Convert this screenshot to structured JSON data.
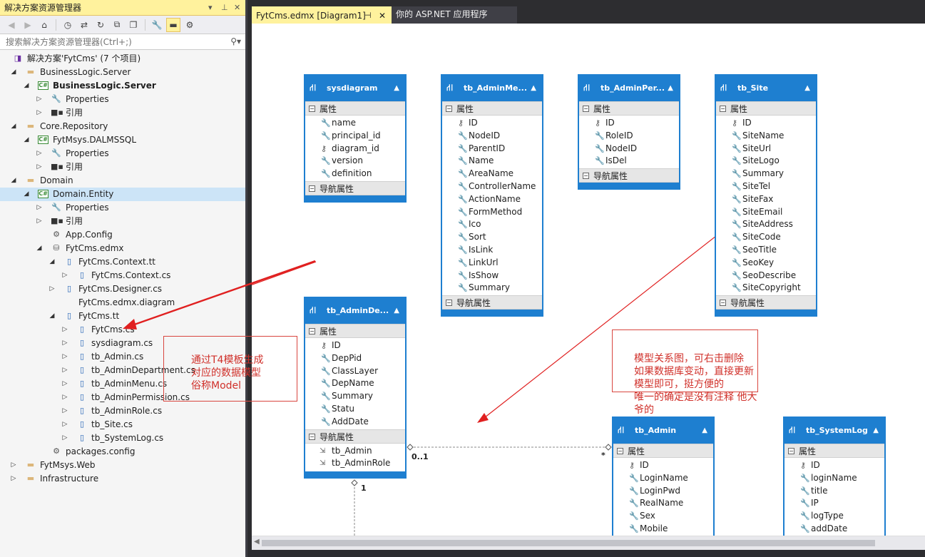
{
  "solution_explorer": {
    "title": "解决方案资源管理器",
    "title_controls": [
      "▾",
      "⊥",
      "✕"
    ],
    "search_placeholder": "搜索解决方案资源管理器(Ctrl+;)",
    "tree": [
      {
        "label": "解决方案'FytCms' (7 个项目)",
        "icon": "solution-icon",
        "depth": 0,
        "expander": ""
      },
      {
        "label": "BusinessLogic.Server",
        "icon": "folder-icon",
        "depth": 1,
        "expander": "open"
      },
      {
        "label": "BusinessLogic.Server",
        "icon": "csharp-project-icon",
        "depth": 2,
        "expander": "open",
        "bold": true
      },
      {
        "label": "Properties",
        "icon": "wrench-icon",
        "depth": 3,
        "expander": "closed"
      },
      {
        "label": "引用",
        "icon": "references-icon",
        "depth": 3,
        "expander": "closed"
      },
      {
        "label": "Core.Repository",
        "icon": "folder-icon",
        "depth": 1,
        "expander": "open"
      },
      {
        "label": "FytMsys.DALMSSQL",
        "icon": "csharp-project-icon",
        "depth": 2,
        "expander": "open"
      },
      {
        "label": "Properties",
        "icon": "wrench-icon",
        "depth": 3,
        "expander": "closed"
      },
      {
        "label": "引用",
        "icon": "references-icon",
        "depth": 3,
        "expander": "closed"
      },
      {
        "label": "Domain",
        "icon": "folder-icon",
        "depth": 1,
        "expander": "open"
      },
      {
        "label": "Domain.Entity",
        "icon": "csharp-project-icon",
        "depth": 2,
        "expander": "open",
        "selected": true
      },
      {
        "label": "Properties",
        "icon": "wrench-icon",
        "depth": 3,
        "expander": "closed"
      },
      {
        "label": "引用",
        "icon": "references-icon",
        "depth": 3,
        "expander": "closed"
      },
      {
        "label": "App.Config",
        "icon": "config-file-icon",
        "depth": 3,
        "expander": ""
      },
      {
        "label": "FytCms.edmx",
        "icon": "edmx-file-icon",
        "depth": 3,
        "expander": "open"
      },
      {
        "label": "FytCms.Context.tt",
        "icon": "tt-file-icon",
        "depth": 4,
        "expander": "open"
      },
      {
        "label": "FytCms.Context.cs",
        "icon": "cs-file-icon",
        "depth": 5,
        "expander": "closed"
      },
      {
        "label": "FytCms.Designer.cs",
        "icon": "cs-file-icon",
        "depth": 4,
        "expander": "closed"
      },
      {
        "label": "FytCms.edmx.diagram",
        "icon": "diagram-file-icon",
        "depth": 4,
        "expander": ""
      },
      {
        "label": "FytCms.tt",
        "icon": "tt-file-icon",
        "depth": 4,
        "expander": "open"
      },
      {
        "label": "FytCms.cs",
        "icon": "cs-file-icon",
        "depth": 5,
        "expander": "closed"
      },
      {
        "label": "sysdiagram.cs",
        "icon": "cs-file-icon",
        "depth": 5,
        "expander": "closed"
      },
      {
        "label": "tb_Admin.cs",
        "icon": "cs-file-icon",
        "depth": 5,
        "expander": "closed"
      },
      {
        "label": "tb_AdminDepartment.cs",
        "icon": "cs-file-icon",
        "depth": 5,
        "expander": "closed"
      },
      {
        "label": "tb_AdminMenu.cs",
        "icon": "cs-file-icon",
        "depth": 5,
        "expander": "closed"
      },
      {
        "label": "tb_AdminPermission.cs",
        "icon": "cs-file-icon",
        "depth": 5,
        "expander": "closed"
      },
      {
        "label": "tb_AdminRole.cs",
        "icon": "cs-file-icon",
        "depth": 5,
        "expander": "closed"
      },
      {
        "label": "tb_Site.cs",
        "icon": "cs-file-icon",
        "depth": 5,
        "expander": "closed"
      },
      {
        "label": "tb_SystemLog.cs",
        "icon": "cs-file-icon",
        "depth": 5,
        "expander": "closed"
      },
      {
        "label": "packages.config",
        "icon": "config-file-icon",
        "depth": 3,
        "expander": ""
      },
      {
        "label": "FytMsys.Web",
        "icon": "folder-icon",
        "depth": 1,
        "expander": "closed"
      },
      {
        "label": "Infrastructure",
        "icon": "folder-icon",
        "depth": 1,
        "expander": "closed"
      }
    ]
  },
  "editor": {
    "tabs": [
      {
        "label": "FytCms.edmx [Diagram1]",
        "active": true
      },
      {
        "label": "你的 ASP.NET 应用程序",
        "active": false
      }
    ]
  },
  "diagram": {
    "section_properties": "属性",
    "section_navigation": "导航属性",
    "entities": [
      {
        "id": "sysdiagram",
        "title": "sysdiagram",
        "properties": [
          "name",
          "principal_id",
          "diagram_id",
          "version",
          "definition"
        ],
        "keys": [
          2
        ],
        "navigation": []
      },
      {
        "id": "tb_AdminMenu",
        "title": "tb_AdminMe...",
        "properties": [
          "ID",
          "NodeID",
          "ParentID",
          "Name",
          "AreaName",
          "ControllerName",
          "ActionName",
          "FormMethod",
          "Ico",
          "Sort",
          "IsLink",
          "LinkUrl",
          "IsShow",
          "Summary"
        ],
        "keys": [
          0
        ],
        "navigation": []
      },
      {
        "id": "tb_AdminPermission",
        "title": "tb_AdminPer...",
        "properties": [
          "ID",
          "RoleID",
          "NodeID",
          "IsDel"
        ],
        "keys": [
          0
        ],
        "navigation": []
      },
      {
        "id": "tb_Site",
        "title": "tb_Site",
        "properties": [
          "ID",
          "SiteName",
          "SiteUrl",
          "SiteLogo",
          "Summary",
          "SiteTel",
          "SiteFax",
          "SiteEmail",
          "SiteAddress",
          "SiteCode",
          "SeoTitle",
          "SeoKey",
          "SeoDescribe",
          "SiteCopyright"
        ],
        "keys": [
          0
        ],
        "navigation": []
      },
      {
        "id": "tb_AdminDepartment",
        "title": "tb_AdminDe...",
        "properties": [
          "ID",
          "DepPid",
          "ClassLayer",
          "DepName",
          "Summary",
          "Statu",
          "AddDate"
        ],
        "keys": [
          0
        ],
        "navigation": [
          "tb_Admin",
          "tb_AdminRole"
        ]
      },
      {
        "id": "tb_Admin",
        "title": "tb_Admin",
        "properties": [
          "ID",
          "LoginName",
          "LoginPwd",
          "RealName",
          "Sex",
          "Mobile"
        ],
        "keys": [
          0
        ],
        "navigation": []
      },
      {
        "id": "tb_SystemLog",
        "title": "tb_SystemLog",
        "properties": [
          "ID",
          "loginName",
          "title",
          "IP",
          "logType",
          "addDate"
        ],
        "keys": [
          0
        ],
        "navigation": []
      }
    ],
    "multiplicities": {
      "dep_side": "0..1",
      "admin_side": "*",
      "lower": "1"
    }
  },
  "annotations": {
    "left_note": "通过T4模板生成\n对应的数据模型\n俗称Model",
    "right_note": "模型关系图，可右击删除\n如果数据库变动，直接更新\n模型即可，挺方便的\n唯一的确定是没有注释  他大爷的",
    "color": "#d9302a"
  },
  "colors": {
    "accent_yellow": "#fff29d",
    "entity_blue": "#1e7fd0",
    "chrome_dark": "#2d2d30",
    "selection": "#cce4f7"
  }
}
